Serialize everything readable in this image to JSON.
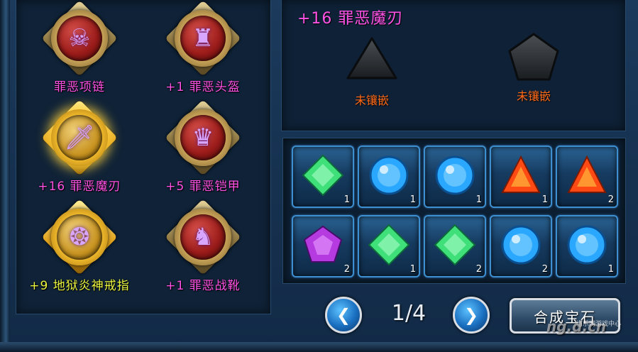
{
  "equipment": [
    {
      "label": "罪恶项链",
      "glyph": "☠",
      "icon": "necklace-icon",
      "color": "#ff52e4"
    },
    {
      "label": "+1 罪恶头盔",
      "glyph": "♜",
      "icon": "helmet-icon",
      "color": "#ff52e4"
    },
    {
      "label": "+16 罪恶魔刃",
      "glyph": "🗡",
      "icon": "blade-icon",
      "color": "#ff52e4",
      "selected": true
    },
    {
      "label": "+5 罪恶铠甲",
      "glyph": "♛",
      "icon": "armor-icon",
      "color": "#ff52e4"
    },
    {
      "label": "+9 地狱炎神戒指",
      "glyph": "❂",
      "icon": "ring-icon",
      "color": "#eaf53f"
    },
    {
      "label": "+1 罪恶战靴",
      "glyph": "♞",
      "icon": "boots-icon",
      "color": "#ff52e4"
    }
  ],
  "detail": {
    "title": "+16 罪恶魔刃",
    "sockets": [
      {
        "shape": "triangle",
        "label": "未镶嵌",
        "icon": "empty-triangle-socket-icon"
      },
      {
        "shape": "pentagon",
        "label": "未镶嵌",
        "icon": "empty-pentagon-socket-icon"
      }
    ]
  },
  "gems": [
    {
      "shape": "square",
      "color": "#3fe07a",
      "count": "1"
    },
    {
      "shape": "circle",
      "color": "#2aa8ff",
      "count": "1"
    },
    {
      "shape": "circle",
      "color": "#2aa8ff",
      "count": "1"
    },
    {
      "shape": "triangle",
      "color": "#ff4a14",
      "count": "1"
    },
    {
      "shape": "triangle",
      "color": "#ff4a14",
      "count": "2"
    },
    {
      "shape": "pentagon",
      "color": "#b53ae0",
      "count": "2"
    },
    {
      "shape": "square",
      "color": "#3fe07a",
      "count": "1"
    },
    {
      "shape": "square",
      "color": "#3fe07a",
      "count": "2"
    },
    {
      "shape": "circle",
      "color": "#2aa8ff",
      "count": "2"
    },
    {
      "shape": "circle",
      "color": "#2aa8ff",
      "count": "1"
    }
  ],
  "pagination": {
    "prev": "❮",
    "current": "1/4",
    "next": "❯"
  },
  "compose_button": "合成宝石",
  "watermark": "ng.d.cn",
  "watermark_small": "当乐网游戏中心"
}
